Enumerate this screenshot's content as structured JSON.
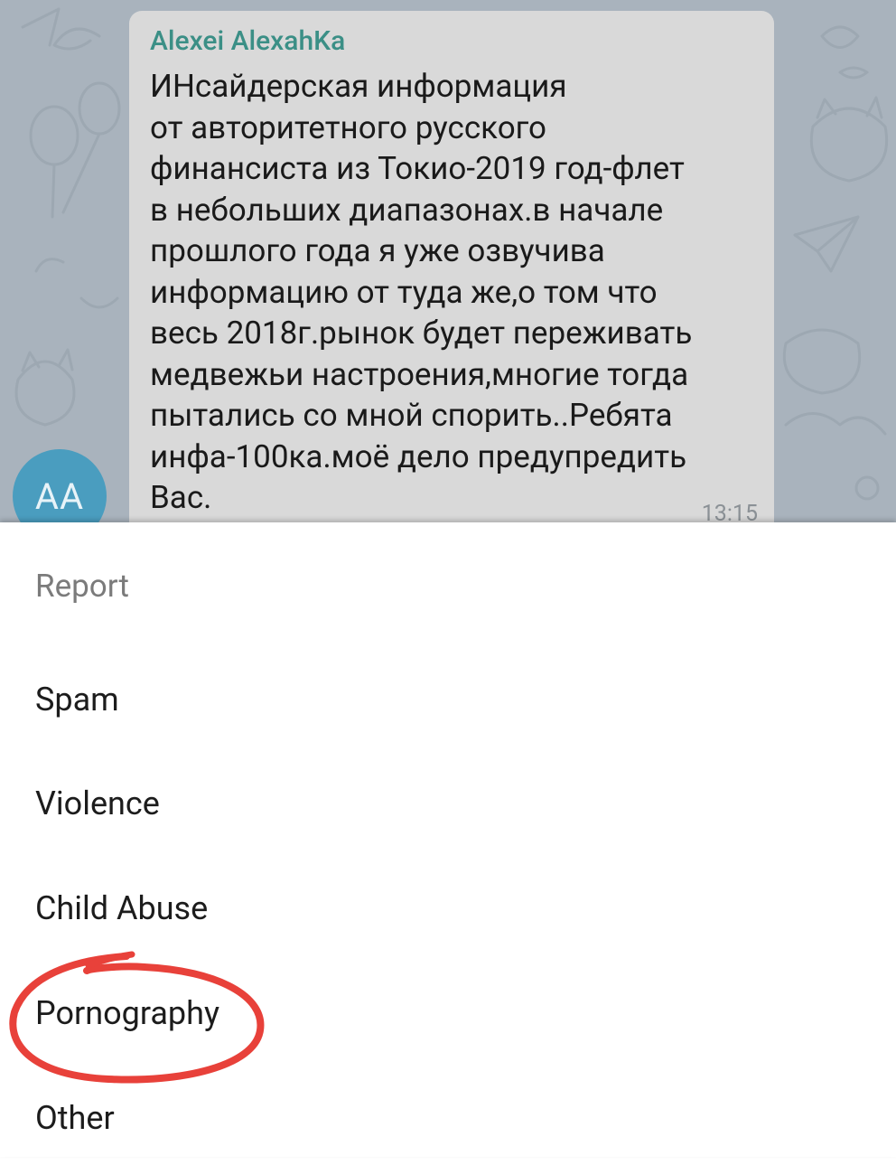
{
  "chat": {
    "sender_name": "Alexei AlexahKa",
    "message": "ИНсайдерская информация\nот авторитетного русского\nфинансиста из Токио-2019 год-флет\nв небольших диапазонах.в начале\nпрошлого года я уже озвучива\nинформацию от туда же,о том что\nвесь 2018г.рынок будет переживать\nмедвежьи настроения,многие тогда\nпытались со мной спорить..Ребята\nинфа-100ка.моё дело предупредить\nВас.",
    "time": "13:15",
    "avatar_initials": "AA"
  },
  "report": {
    "title": "Report",
    "options": [
      "Spam",
      "Violence",
      "Child Abuse",
      "Pornography",
      "Other"
    ]
  },
  "colors": {
    "chat_background": "#a9b3bd",
    "bubble": "#d9d9d9",
    "sender_name": "#3b8f86",
    "avatar": "#4a9dbf",
    "annotation": "#e8413a"
  }
}
